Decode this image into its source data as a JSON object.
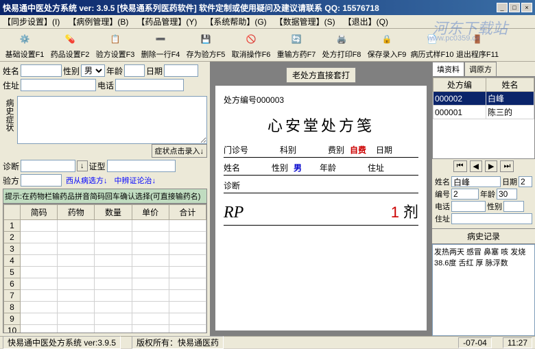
{
  "window": {
    "title": "快易通中医处方系统  ver: 3.9.5 [快易通系列医药软件]       软件定制或使用疑问及建议请联系  QQ: 15576718"
  },
  "menu": {
    "items": [
      "【同步设置】(I)",
      "【病例管理】(B)",
      "【药品管理】(Y)",
      "【系统帮助】(G)",
      "【数据管理】(S)",
      "【退出】(Q)"
    ]
  },
  "toolbar": {
    "items": [
      {
        "label": "基础设置F1",
        "icon": "gear"
      },
      {
        "label": "药品设置F2",
        "icon": "pill"
      },
      {
        "label": "验方设置F3",
        "icon": "list"
      },
      {
        "label": "删除一行F4",
        "icon": "delete"
      },
      {
        "label": "存为验方F5",
        "icon": "save"
      },
      {
        "label": "取消操作F6",
        "icon": "cancel"
      },
      {
        "label": "重输方药F7",
        "icon": "refresh"
      },
      {
        "label": "处方打印F8",
        "icon": "print"
      },
      {
        "label": "保存录入F9",
        "icon": "lock"
      },
      {
        "label": "病历式样F10",
        "icon": "doc"
      },
      {
        "label": "退出程序F11",
        "icon": "exit"
      }
    ]
  },
  "left": {
    "labels": {
      "name": "姓名",
      "sex": "性别",
      "age": "年龄",
      "date": "日期",
      "addr": "住址",
      "phone": "电话",
      "history": "病史症状",
      "diag": "诊断",
      "pattern": "证型",
      "rx": "验方",
      "symptomBtn": "症状点击录入↓",
      "westBtn": "西从病选方↓",
      "tcmBtn": "中辨证论治↓"
    },
    "sexValue": "男",
    "hint": "提示:在药物栏输药品拼音简码回车确认选择(可直接输药名)",
    "gridHeaders": [
      "简码",
      "药物",
      "数量",
      "单价",
      "合计"
    ],
    "rowCount": 11
  },
  "center": {
    "topbtn": "老处方直接套打",
    "rxno_label": "处方编号",
    "rxno": "000003",
    "title": "心安堂处方笺",
    "row1": {
      "clinic": "门诊号",
      "dept": "科别",
      "feeType": "费别",
      "feeVal": "自费",
      "date": "日期"
    },
    "row2": {
      "name": "姓名",
      "sex": "性别",
      "sexVal": "男",
      "age": "年龄",
      "addr": "住址"
    },
    "row3": {
      "diag": "诊断"
    },
    "rp": "RP",
    "doseNum": "1",
    "doseUnit": "剂"
  },
  "right": {
    "tabs": [
      "填资料",
      "调原方"
    ],
    "listHeaders": [
      "处方编",
      "姓名"
    ],
    "listRows": [
      {
        "no": "000002",
        "name": "白峰"
      },
      {
        "no": "000001",
        "name": "陈三的"
      }
    ],
    "navIcons": [
      "first",
      "prev",
      "next",
      "last"
    ],
    "form": {
      "name": "姓名",
      "nameVal": "白峰",
      "date": "日期",
      "dateVal": "2",
      "idno": "编号",
      "idnoVal": "2",
      "age": "年龄",
      "ageVal": "30",
      "phone": "电话",
      "sex": "性别",
      "addr": "住址"
    },
    "hxTitle": "病史记录",
    "hxText": "发热两天 感冒 鼻塞 咳 发烧 38.6度 舌红 厚 脉浮数"
  },
  "status": {
    "app": "快易通中医处方系统  ver:3.9.5",
    "copyright": "版权所有：快易通医药",
    "date": "-07-04",
    "time": "11:27"
  },
  "watermark": "河东下载站",
  "watermark_url": "www.pc0359.cn"
}
